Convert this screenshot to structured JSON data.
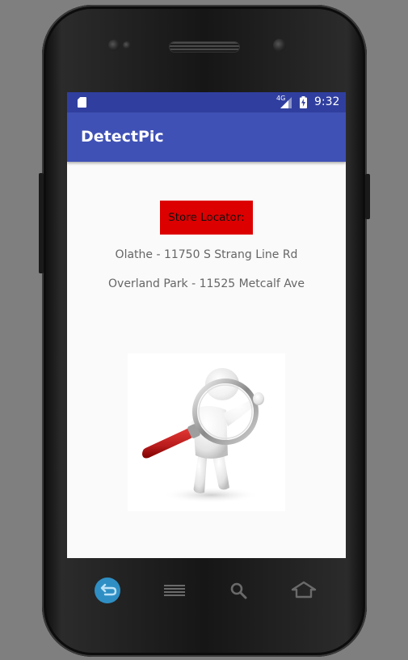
{
  "status_bar": {
    "sd_card_icon": "sd-card-icon",
    "network_type": "4G",
    "signal_icon": "cell-signal-icon",
    "battery_icon": "battery-charging-icon",
    "time": "9:32"
  },
  "app_bar": {
    "title": "DetectPic",
    "background_color": "#3f51b5",
    "status_color": "#303f9f"
  },
  "main": {
    "store_locator_button": {
      "label": "Store Locator:",
      "color": "#dd0000"
    },
    "locations": [
      "Olathe - 11750 S Strang Line Rd",
      "Overland Park - 11525 Metcalf Ave"
    ],
    "picture": {
      "icon": "magnifying-glass-person-illustration"
    }
  },
  "navigation": {
    "back_icon": "back-icon",
    "menu_icon": "menu-icon",
    "search_icon": "search-icon",
    "home_icon": "home-icon"
  }
}
